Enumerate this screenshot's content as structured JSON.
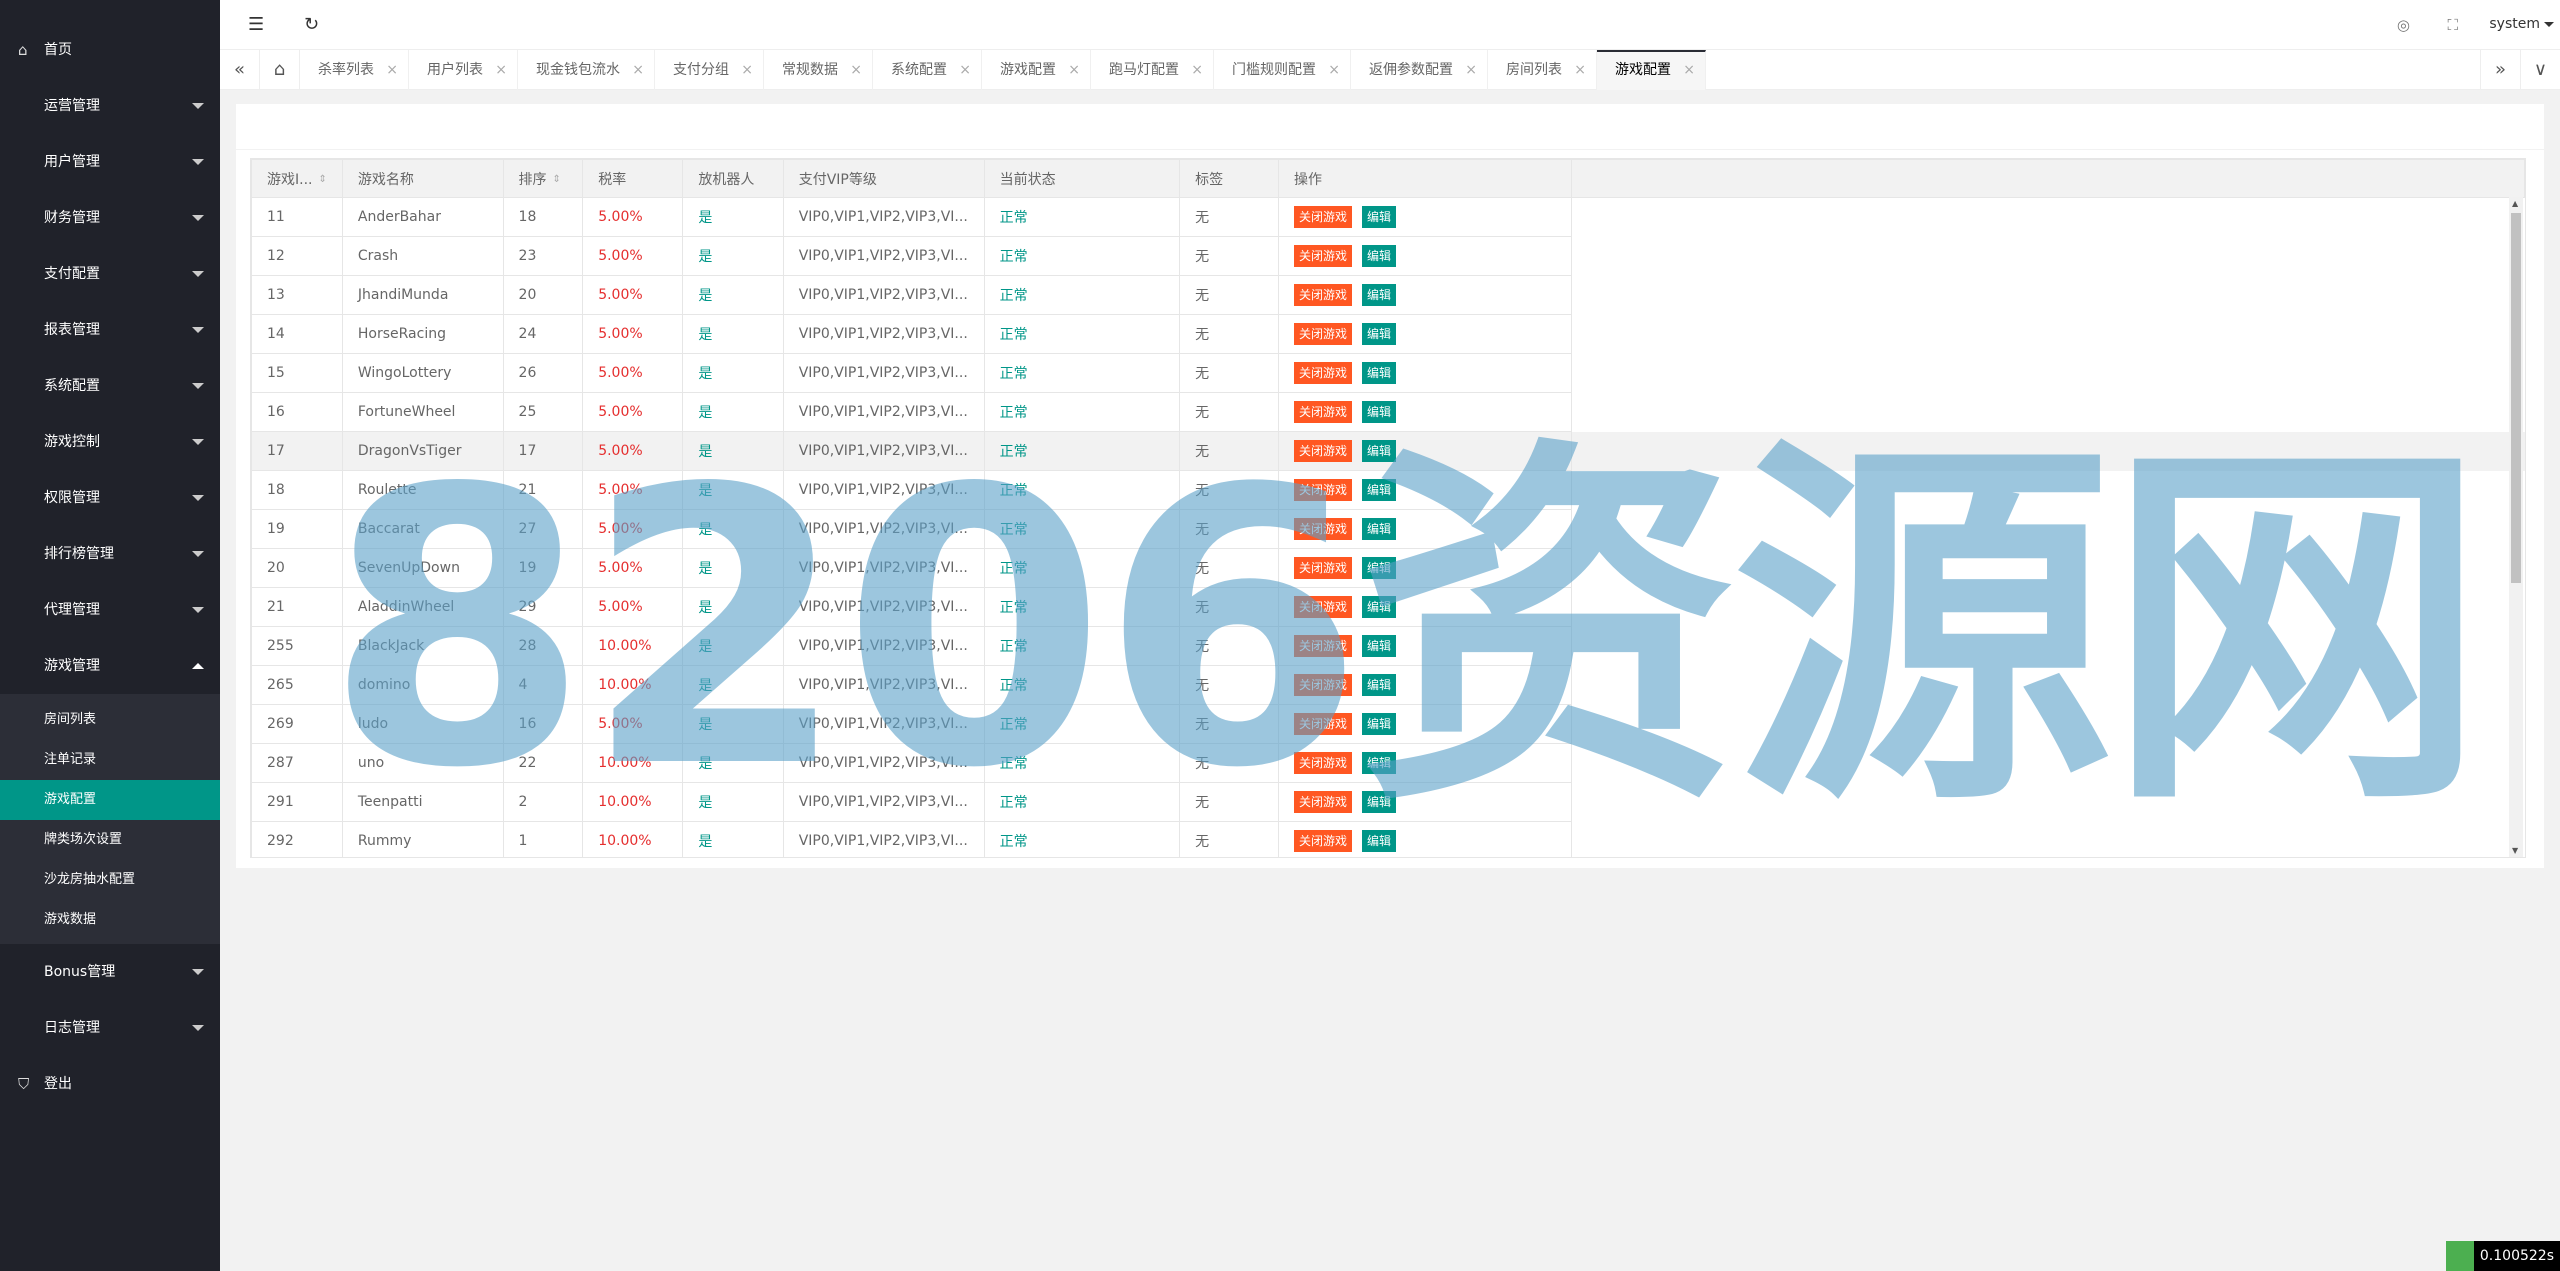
{
  "sidebar": {
    "home": "首页",
    "menus": [
      "运营管理",
      "用户管理",
      "财务管理",
      "支付配置",
      "报表管理",
      "系统配置",
      "游戏控制",
      "权限管理",
      "排行榜管理",
      "代理管理"
    ],
    "game_mgmt": "游戏管理",
    "game_sub": [
      "房间列表",
      "注单记录",
      "游戏配置",
      "牌类场次设置",
      "沙龙房抽水配置",
      "游戏数据"
    ],
    "menus_after": [
      "Bonus管理",
      "日志管理"
    ],
    "logout": "登出"
  },
  "header": {
    "menu_icon": "☰",
    "refresh_icon": "↻",
    "theme_icon": "◎",
    "fullscreen_icon": "⛶",
    "user": "system"
  },
  "tabs": {
    "prev_icon": "«",
    "home_icon": "⌂",
    "items": [
      "杀率列表",
      "用户列表",
      "现金钱包流水",
      "支付分组",
      "常规数据",
      "系统配置",
      "游戏配置",
      "跑马灯配置",
      "门槛规则配置",
      "返佣参数配置",
      "房间列表",
      "游戏配置"
    ],
    "close": "×",
    "next_icon": "»",
    "more_icon": "∨"
  },
  "table": {
    "headers": [
      "游戏I...",
      "游戏名称",
      "排序",
      "税率",
      "放机器人",
      "支付VIP等级",
      "当前状态",
      "标签",
      "操作"
    ],
    "sort_icon": "⇕",
    "close_btn": "关闭游戏",
    "edit_btn": "编辑",
    "rows": [
      {
        "id": "11",
        "name": "AnderBahar",
        "order": "18",
        "tax": "5.00%",
        "robot": "是",
        "vip": "VIP0,VIP1,VIP2,VIP3,VI...",
        "status": "正常",
        "tag": "无"
      },
      {
        "id": "12",
        "name": "Crash",
        "order": "23",
        "tax": "5.00%",
        "robot": "是",
        "vip": "VIP0,VIP1,VIP2,VIP3,VI...",
        "status": "正常",
        "tag": "无"
      },
      {
        "id": "13",
        "name": "JhandiMunda",
        "order": "20",
        "tax": "5.00%",
        "robot": "是",
        "vip": "VIP0,VIP1,VIP2,VIP3,VI...",
        "status": "正常",
        "tag": "无"
      },
      {
        "id": "14",
        "name": "HorseRacing",
        "order": "24",
        "tax": "5.00%",
        "robot": "是",
        "vip": "VIP0,VIP1,VIP2,VIP3,VI...",
        "status": "正常",
        "tag": "无"
      },
      {
        "id": "15",
        "name": "WingoLottery",
        "order": "26",
        "tax": "5.00%",
        "robot": "是",
        "vip": "VIP0,VIP1,VIP2,VIP3,VI...",
        "status": "正常",
        "tag": "无"
      },
      {
        "id": "16",
        "name": "FortuneWheel",
        "order": "25",
        "tax": "5.00%",
        "robot": "是",
        "vip": "VIP0,VIP1,VIP2,VIP3,VI...",
        "status": "正常",
        "tag": "无"
      },
      {
        "id": "17",
        "name": "DragonVsTiger",
        "order": "17",
        "tax": "5.00%",
        "robot": "是",
        "vip": "VIP0,VIP1,VIP2,VIP3,VI...",
        "status": "正常",
        "tag": "无"
      },
      {
        "id": "18",
        "name": "Roulette",
        "order": "21",
        "tax": "5.00%",
        "robot": "是",
        "vip": "VIP0,VIP1,VIP2,VIP3,VI...",
        "status": "正常",
        "tag": "无"
      },
      {
        "id": "19",
        "name": "Baccarat",
        "order": "27",
        "tax": "5.00%",
        "robot": "是",
        "vip": "VIP0,VIP1,VIP2,VIP3,VI...",
        "status": "正常",
        "tag": "无"
      },
      {
        "id": "20",
        "name": "SevenUpDown",
        "order": "19",
        "tax": "5.00%",
        "robot": "是",
        "vip": "VIP0,VIP1,VIP2,VIP3,VI...",
        "status": "正常",
        "tag": "无"
      },
      {
        "id": "21",
        "name": "AladdinWheel",
        "order": "29",
        "tax": "5.00%",
        "robot": "是",
        "vip": "VIP0,VIP1,VIP2,VIP3,VI...",
        "status": "正常",
        "tag": "无"
      },
      {
        "id": "255",
        "name": "BlackJack",
        "order": "28",
        "tax": "10.00%",
        "robot": "是",
        "vip": "VIP0,VIP1,VIP2,VIP3,VI...",
        "status": "正常",
        "tag": "无"
      },
      {
        "id": "265",
        "name": "domino",
        "order": "4",
        "tax": "10.00%",
        "robot": "是",
        "vip": "VIP0,VIP1,VIP2,VIP3,VI...",
        "status": "正常",
        "tag": "无"
      },
      {
        "id": "269",
        "name": "ludo",
        "order": "16",
        "tax": "5.00%",
        "robot": "是",
        "vip": "VIP0,VIP1,VIP2,VIP3,VI...",
        "status": "正常",
        "tag": "无"
      },
      {
        "id": "287",
        "name": "uno",
        "order": "22",
        "tax": "10.00%",
        "robot": "是",
        "vip": "VIP0,VIP1,VIP2,VIP3,VI...",
        "status": "正常",
        "tag": "无"
      },
      {
        "id": "291",
        "name": "Teenpatti",
        "order": "2",
        "tax": "10.00%",
        "robot": "是",
        "vip": "VIP0,VIP1,VIP2,VIP3,VI...",
        "status": "正常",
        "tag": "无"
      },
      {
        "id": "292",
        "name": "Rummy",
        "order": "1",
        "tax": "10.00%",
        "robot": "是",
        "vip": "VIP0,VIP1,VIP2,VIP3,VI...",
        "status": "正常",
        "tag": "无"
      }
    ]
  },
  "watermark": "8206资源网",
  "timer": "0.100522s",
  "colors": {
    "sidebar": "#20222a",
    "active": "#009688",
    "danger": "#ff5722",
    "tax": "#e52e2e"
  }
}
